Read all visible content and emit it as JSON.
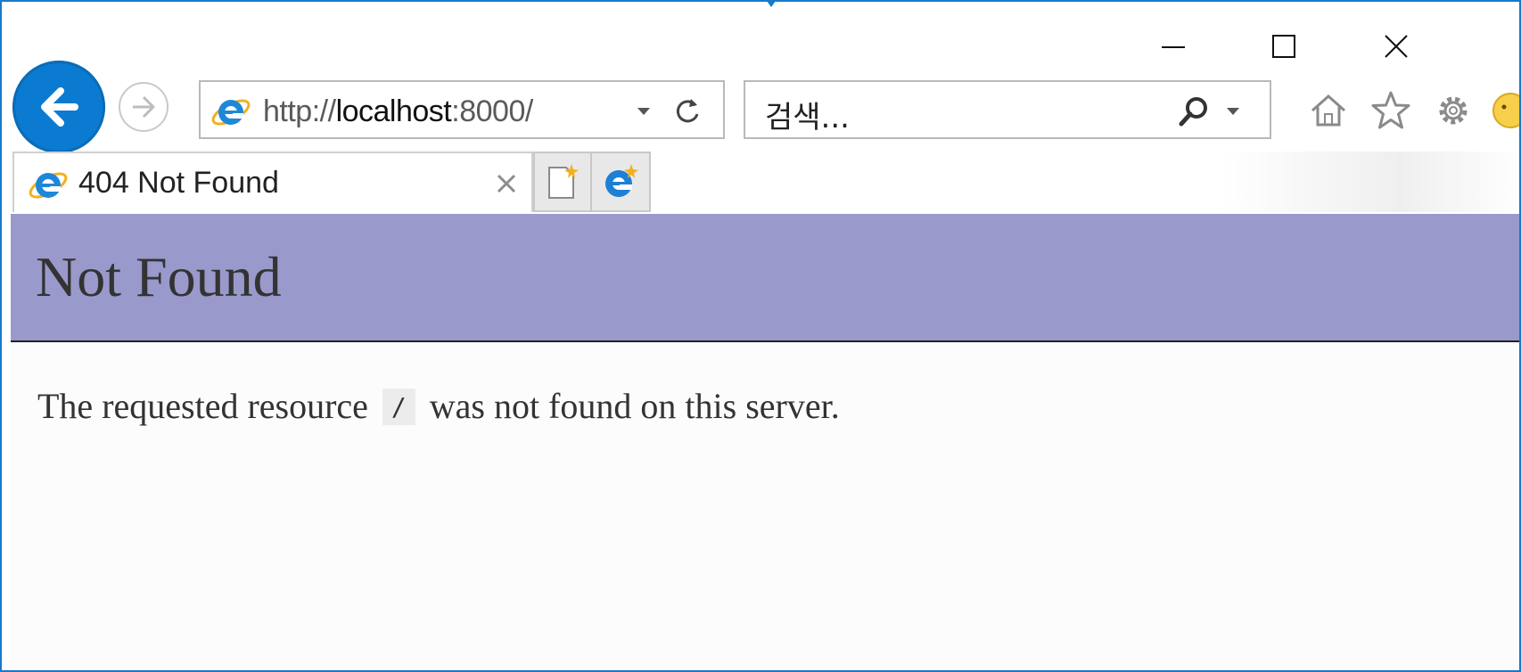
{
  "window": {
    "controls": {
      "minimize": "minimize",
      "maximize": "maximize",
      "close": "close"
    }
  },
  "toolbar": {
    "address": {
      "prefix": "http://",
      "host": "localhost",
      "suffix": ":8000/"
    },
    "search": {
      "placeholder": "검색..."
    }
  },
  "tabs": [
    {
      "title": "404 Not Found"
    }
  ],
  "page": {
    "heading": "Not Found",
    "message_before": "The requested resource",
    "resource": "/",
    "message_after": "was not found on this server."
  },
  "colors": {
    "banner": "#9999cc",
    "window_border": "#1979ca",
    "back_button": "#0b7bd1"
  }
}
